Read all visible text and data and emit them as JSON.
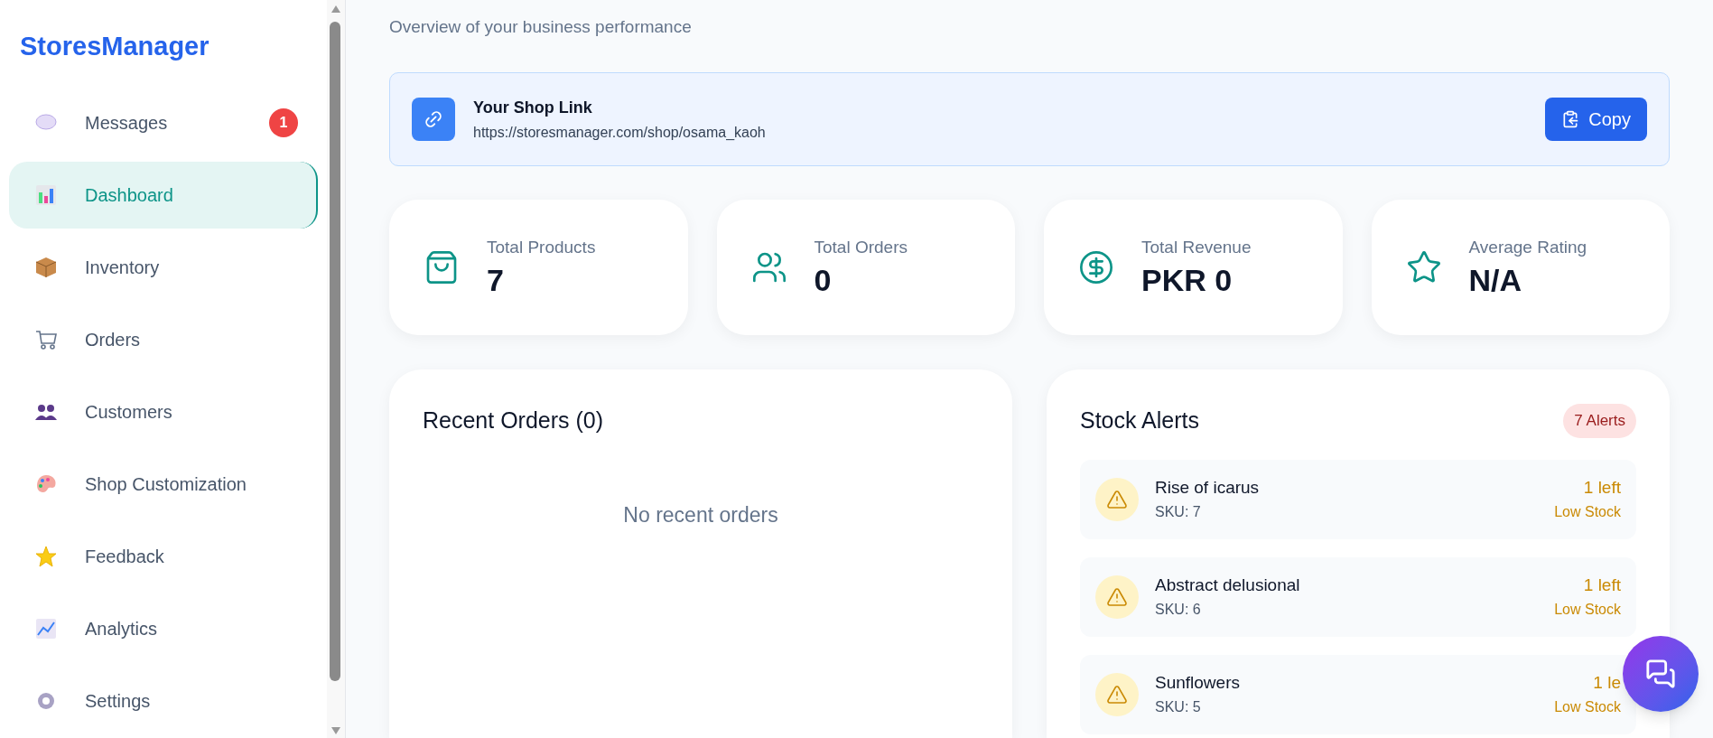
{
  "sidebar": {
    "logo": "StoresManager",
    "items": [
      {
        "label": "Messages",
        "selected": false,
        "badge": "1"
      },
      {
        "label": "Dashboard",
        "selected": true
      },
      {
        "label": "Inventory",
        "selected": false
      },
      {
        "label": "Orders",
        "selected": false
      },
      {
        "label": "Customers",
        "selected": false
      },
      {
        "label": "Shop Customization",
        "selected": false
      },
      {
        "label": "Feedback",
        "selected": false
      },
      {
        "label": "Analytics",
        "selected": false
      },
      {
        "label": "Settings",
        "selected": false
      }
    ]
  },
  "header": {
    "subtitle": "Overview of your business performance"
  },
  "shop_link": {
    "title": "Your Shop Link",
    "url": "https://storesmanager.com/shop/osama_kaoh",
    "button": "Copy"
  },
  "stats": [
    {
      "kind": "products",
      "label": "Total Products",
      "value": "7"
    },
    {
      "kind": "orders",
      "label": "Total Orders",
      "value": "0"
    },
    {
      "kind": "revenue",
      "label": "Total Revenue",
      "value": "PKR 0"
    },
    {
      "kind": "rating",
      "label": "Average Rating",
      "value": "N/A"
    }
  ],
  "recent_orders": {
    "title": "Recent Orders (0)",
    "empty": "No recent orders"
  },
  "stock_alerts": {
    "title": "Stock Alerts",
    "badge": "7 Alerts",
    "items": [
      {
        "name": "Rise of icarus",
        "sku": "SKU: 7",
        "left": "1 left",
        "status": "Low Stock"
      },
      {
        "name": "Abstract delusional",
        "sku": "SKU: 6",
        "left": "1 left",
        "status": "Low Stock"
      },
      {
        "name": "Sunflowers",
        "sku": "SKU: 5",
        "left": "1 le",
        "status": "Low Stock"
      }
    ]
  }
}
